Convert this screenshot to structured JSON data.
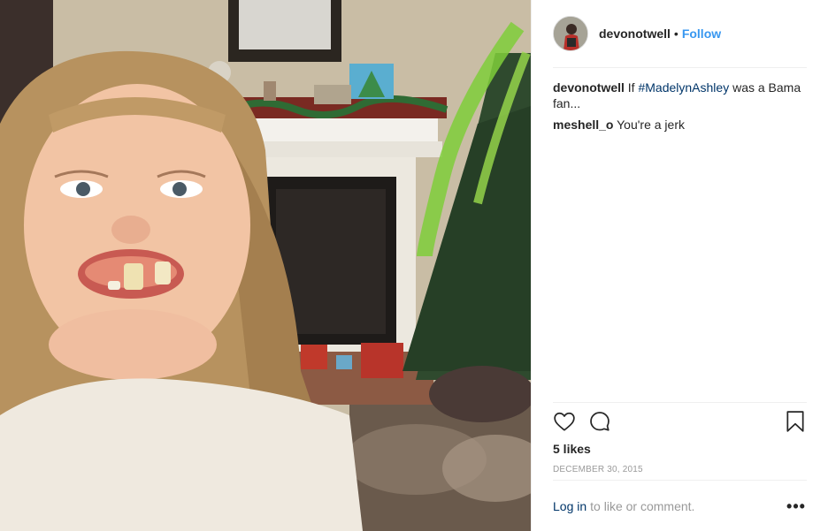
{
  "post": {
    "photo_icon": "photo-selfie-girl-fake-teeth",
    "username": "devonotwell",
    "separator": "•",
    "follow_label": "Follow",
    "comments": [
      {
        "user": "devonotwell",
        "text_before": " If ",
        "hashtag": "#MadelynAshley",
        "text_after": " was a Bama fan..."
      },
      {
        "user": "meshell_o",
        "text": " You're a jerk"
      }
    ],
    "likes": "5 likes",
    "date": "DECEMBER 30, 2015",
    "footer": {
      "login_label": "Log in",
      "rest": "to like or comment.",
      "more": "•••"
    }
  },
  "icons": {
    "like": "heart-icon",
    "comment": "comment-bubble-icon",
    "save": "bookmark-icon",
    "more": "more-options-icon"
  },
  "colors": {
    "link": "#3897f0",
    "hashtag": "#003569",
    "muted": "#999999",
    "text": "#262626"
  }
}
